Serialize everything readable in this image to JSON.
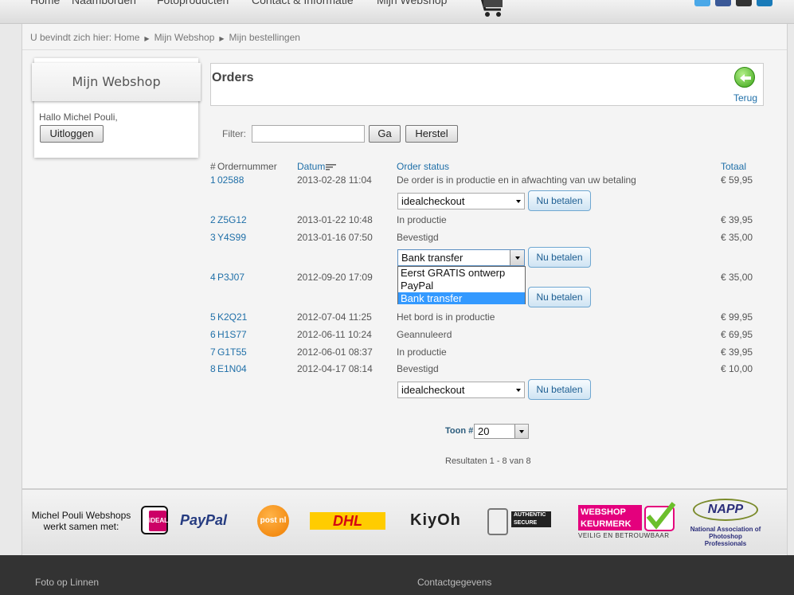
{
  "nav": {
    "items": [
      "Home",
      "Naamborden",
      "Fotoproducten",
      "Contact & Informatie",
      "Mijn Webshop"
    ]
  },
  "breadcrumb": {
    "prefix": "U bevindt zich hier:",
    "items": [
      "Home",
      "Mijn Webshop",
      "Mijn bestellingen"
    ]
  },
  "sidebar": {
    "title": "Mijn Webshop",
    "greeting": "Hallo Michel Pouli,",
    "logout": "Uitloggen"
  },
  "orders": {
    "title": "Orders",
    "back": "Terug",
    "filter_label": "Filter:",
    "filter_value": "",
    "go": "Ga",
    "reset": "Herstel",
    "headers": {
      "hash": "#",
      "number": "Ordernummer",
      "date": "Datum",
      "status": "Order status",
      "total": "Totaal"
    },
    "rows": [
      {
        "idx": "1",
        "number": "02588",
        "date": "2013-02-28 11:04",
        "status": "De order is in productie en in afwachting van uw betaling",
        "total": "€ 59,95",
        "payment": "idealcheckout",
        "pay": "Nu betalen"
      },
      {
        "idx": "2",
        "number": "Z5G12",
        "date": "2013-01-22 10:48",
        "status": "In productie",
        "total": "€ 39,95"
      },
      {
        "idx": "3",
        "number": "Y4S99",
        "date": "2013-01-16 07:50",
        "status": "Bevestigd",
        "total": "€ 35,00",
        "payment": "Bank transfer",
        "pay": "Nu betalen"
      },
      {
        "idx": "4",
        "number": "P3J07",
        "date": "2012-09-20 17:09",
        "status": "",
        "total": "€ 35,00",
        "pay": "Nu betalen"
      },
      {
        "idx": "5",
        "number": "K2Q21",
        "date": "2012-07-04 11:25",
        "status": "Het bord is in productie",
        "total": "€ 99,95"
      },
      {
        "idx": "6",
        "number": "H1S77",
        "date": "2012-06-11 10:24",
        "status": "Geannuleerd",
        "total": "€ 69,95"
      },
      {
        "idx": "7",
        "number": "G1T55",
        "date": "2012-06-01 08:37",
        "status": "In productie",
        "total": "€ 39,95"
      },
      {
        "idx": "8",
        "number": "E1N04",
        "date": "2012-04-17 08:14",
        "status": "Bevestigd",
        "total": "€ 10,00",
        "payment": "idealcheckout",
        "pay": "Nu betalen"
      }
    ],
    "dropdown_options": [
      "Eerst GRATIS ontwerp",
      "PayPal",
      "Bank transfer"
    ],
    "dropdown_selected": "Bank transfer",
    "toon_label": "Toon #",
    "toon_value": "20",
    "results": "Resultaten 1 - 8 van 8"
  },
  "partners": {
    "text": "Michel Pouli Webshops werkt samen met:",
    "logos": {
      "ideal": "iDEAL",
      "paypal": "PayPal",
      "postnl": "post nl",
      "dhl": "DHL",
      "kiyoh": "KiyOh",
      "comodo": "AUTHENTIC SECURE",
      "webshop": "WEBSHOP KEURMERK",
      "webshop_sub": "VEILIG EN BETROUWBAAR",
      "napp": "NAPP",
      "napp_sub": "National Association of Photoshop Professionals"
    }
  },
  "footer": {
    "col1": "Foto op Linnen",
    "col2": "Contactgegevens"
  },
  "colors": {
    "link": "#1f6fa8",
    "dropdown_highlight": "#3399ff",
    "footer_bg": "#333333"
  }
}
